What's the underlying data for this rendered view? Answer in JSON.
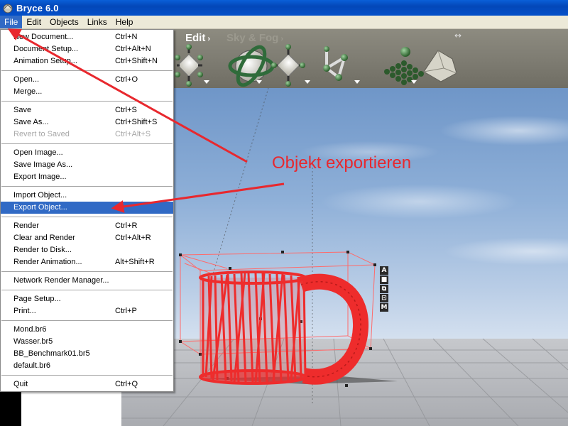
{
  "window": {
    "title": "Bryce 6.0"
  },
  "menubar": {
    "items": [
      "File",
      "Edit",
      "Objects",
      "Links",
      "Help"
    ],
    "active": "File"
  },
  "toolbar": {
    "tab_edit": "Edit",
    "tab_sky": "Sky & Fog",
    "tab_arrow": "›",
    "expand": "↔"
  },
  "side_tools": [
    "A",
    "■",
    "⧉",
    "⊡",
    "M"
  ],
  "file_menu": {
    "groups": [
      [
        {
          "label": "New Document...",
          "shortcut": "Ctrl+N"
        },
        {
          "label": "Document Setup...",
          "shortcut": "Ctrl+Alt+N"
        },
        {
          "label": "Animation Setup...",
          "shortcut": "Ctrl+Shift+N"
        }
      ],
      [
        {
          "label": "Open...",
          "shortcut": "Ctrl+O"
        },
        {
          "label": "Merge...",
          "shortcut": ""
        }
      ],
      [
        {
          "label": "Save",
          "shortcut": "Ctrl+S"
        },
        {
          "label": "Save As...",
          "shortcut": "Ctrl+Shift+S"
        },
        {
          "label": "Revert to Saved",
          "shortcut": "Ctrl+Alt+S",
          "disabled": true
        }
      ],
      [
        {
          "label": "Open Image...",
          "shortcut": ""
        },
        {
          "label": "Save Image As...",
          "shortcut": ""
        },
        {
          "label": "Export Image...",
          "shortcut": ""
        }
      ],
      [
        {
          "label": "Import Object...",
          "shortcut": ""
        },
        {
          "label": "Export Object...",
          "shortcut": "",
          "highlighted": true
        }
      ],
      [
        {
          "label": "Render",
          "shortcut": "Ctrl+R"
        },
        {
          "label": "Clear and Render",
          "shortcut": "Ctrl+Alt+R"
        },
        {
          "label": "Render to Disk...",
          "shortcut": ""
        },
        {
          "label": "Render Animation...",
          "shortcut": "Alt+Shift+R"
        }
      ],
      [
        {
          "label": "Network Render Manager...",
          "shortcut": ""
        }
      ],
      [
        {
          "label": "Page Setup...",
          "shortcut": ""
        },
        {
          "label": "Print...",
          "shortcut": "Ctrl+P"
        }
      ],
      [
        {
          "label": "Mond.br6",
          "shortcut": ""
        },
        {
          "label": "Wasser.br5",
          "shortcut": ""
        },
        {
          "label": "BB_Benchmark01.br5",
          "shortcut": ""
        },
        {
          "label": "default.br6",
          "shortcut": ""
        }
      ],
      [
        {
          "label": "Quit",
          "shortcut": "Ctrl+Q"
        }
      ]
    ]
  },
  "annotation": {
    "text": "Objekt exportieren",
    "color": "#e8282e"
  },
  "colors": {
    "menu_highlight": "#316ac5",
    "title_bar": "#0450c9",
    "mug_wire": "#ee2c2c"
  }
}
